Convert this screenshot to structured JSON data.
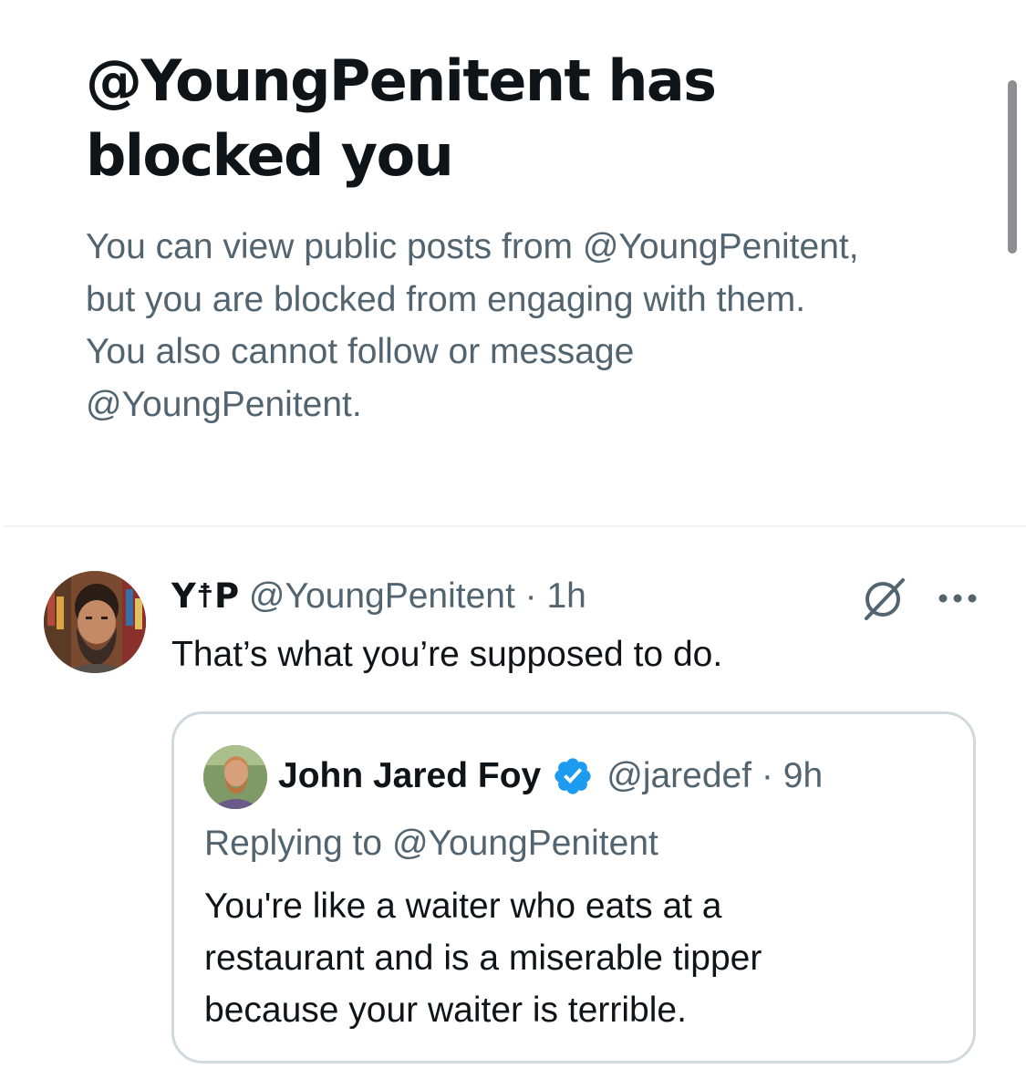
{
  "blocked_notice": {
    "title_line1": "@YoungPenitent has",
    "title_line2": "blocked you",
    "description_lines": [
      "You can view public posts from @YoungPenitent,",
      "but you are blocked from engaging with them.",
      "You also cannot follow or message",
      "@YoungPenitent."
    ]
  },
  "post": {
    "author_name": "Y☨P",
    "handle": "@YoungPenitent",
    "separator": " · ",
    "time": "1h",
    "text": "That’s what you’re supposed to do.",
    "icons": {
      "grok": "grok-icon",
      "more": "more-icon"
    }
  },
  "quoted_post": {
    "author_name": "John Jared Foy",
    "verified": true,
    "handle": "@jaredef",
    "separator": " · ",
    "time": "9h",
    "replying_to": "Replying to @YoungPenitent",
    "text_lines": [
      "You're like a waiter who eats at a",
      "restaurant and is a miserable tipper",
      "because your waiter is terrible."
    ]
  },
  "colors": {
    "text_primary": "#0f1419",
    "text_secondary": "#536471",
    "border": "#cfd9de",
    "verified": "#1d9bf0"
  }
}
